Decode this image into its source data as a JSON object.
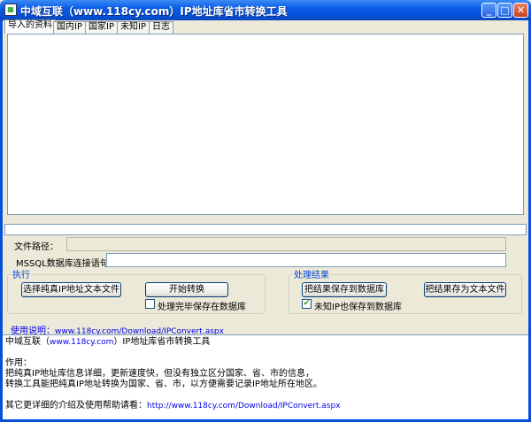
{
  "window": {
    "title": "中域互联（www.118cy.com）IP地址库省市转换工具",
    "minimize": "_",
    "maximize": "□",
    "close": "✕"
  },
  "tabs": [
    "导入的资料",
    "国内IP",
    "国家IP",
    "未知IP",
    "日志"
  ],
  "form": {
    "file_path_label": "文件路径：",
    "file_path_value": "",
    "mssql_label": "MSSQL数据库连接语句：",
    "mssql_value": ""
  },
  "execute_group": {
    "title": "执行",
    "select_file_button": "选择纯真IP地址文本文件",
    "start_button": "开始转换",
    "save_after_checkbox": "处理完毕保存在数据库",
    "save_after_checked": false
  },
  "result_group": {
    "title": "处理结果",
    "save_db_button": "把结果保存到数据库",
    "save_text_button": "把结果存为文本文件",
    "unknown_ip_checkbox": "未知IP也保存到数据库",
    "unknown_ip_checked": true
  },
  "help_link": {
    "label": "使用说明：",
    "url": "www.118cy.com/Download/IPConvert.aspx"
  },
  "info": {
    "line1_pre": "中域互联（",
    "line1_link": "www.118cy.com",
    "line1_post": "）IP地址库省市转换工具",
    "heading": "作用：",
    "line2": "把纯真IP地址库信息详细，更新速度快，但没有独立区分国家、省、市的信息，",
    "line3": "转换工具能把纯真IP地址转换为国家、省、市，以方便需要记录IP地址所在地区。",
    "line4_pre": "其它更详细的介绍及使用帮助请看：",
    "line4_link": "http://www.118cy.com/Download/IPConvert.aspx"
  }
}
